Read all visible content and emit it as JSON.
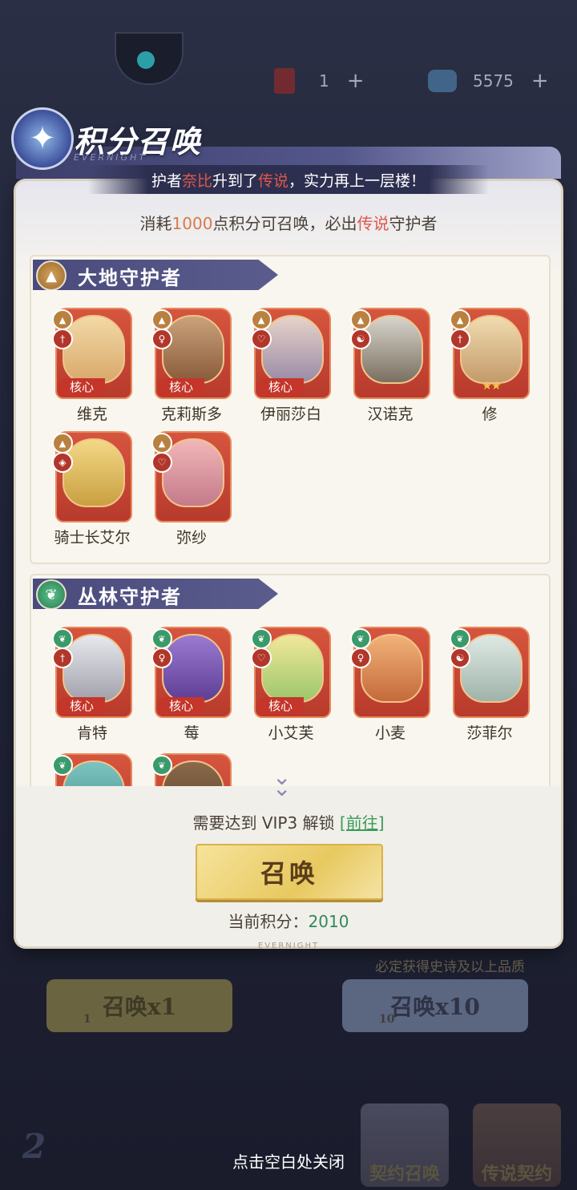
{
  "background": {
    "resources": [
      {
        "icon": "summon-ticket-icon",
        "value": "1"
      },
      {
        "icon": "diamond-icon",
        "value": "5575"
      }
    ],
    "summon_x1": {
      "label": "召唤x1",
      "cost": "1"
    },
    "summon_x10": {
      "label": "召唤x10",
      "cost": "10"
    },
    "note_fragment": "必定获得史诗及以上品质",
    "tabs": [
      "契约召唤",
      "传说契约"
    ]
  },
  "modal": {
    "title": "积分召唤",
    "title_sub": "EVERNIGHT",
    "subtitle": {
      "p1": "护者",
      "hero": "奈比",
      "p2": "升到了",
      "rank": "传说",
      "p3": "，实力再上一层楼！"
    },
    "info": {
      "p1": "消耗",
      "cost": "1000",
      "p2": "点积分可召唤，必出",
      "rank": "传说",
      "p3": "守护者"
    },
    "sections": [
      {
        "title": "大地守护者",
        "element": "earth",
        "heroes": [
          {
            "name": "维克",
            "core": "核心"
          },
          {
            "name": "克莉斯多",
            "core": "核心"
          },
          {
            "name": "伊丽莎白",
            "core": "核心"
          },
          {
            "name": "汉诺克"
          },
          {
            "name": "修",
            "stars": "★★"
          },
          {
            "name": "骑士长艾尔"
          },
          {
            "name": "弥纱"
          }
        ]
      },
      {
        "title": "丛林守护者",
        "element": "jungle",
        "heroes": [
          {
            "name": "肯特",
            "core": "核心"
          },
          {
            "name": "莓",
            "core": "核心"
          },
          {
            "name": "小艾芙",
            "core": "核心"
          },
          {
            "name": "小麦"
          },
          {
            "name": "莎菲尔"
          }
        ]
      }
    ],
    "vip": {
      "text": "需要达到 VIP3 解锁",
      "link": "[前往]"
    },
    "summon_button": "召唤",
    "points": {
      "label": "当前积分：",
      "value": "2010"
    },
    "footer_brand": "EVERNIGHT"
  },
  "close_hint": "点击空白处关闭",
  "colors": {
    "accent_red": "#e0584a",
    "accent_orange": "#d97a4a",
    "accent_green": "#2e8a5a",
    "header_purple": "#4a4b7c"
  }
}
